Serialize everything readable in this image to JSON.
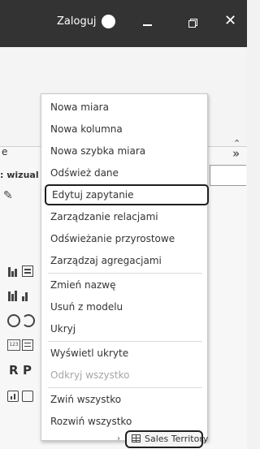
{
  "titlebar": {
    "login_label": "Zaloguj",
    "close_glyph": "✕"
  },
  "ribbon": {
    "caret": "⌃"
  },
  "pane": {
    "partial_header": "e",
    "visualizations_label": ": wizual",
    "expand_glyph": "»",
    "visual_letters": {
      "r": "R",
      "p": "P"
    }
  },
  "context_menu": {
    "items": [
      {
        "label": "Nowa miara",
        "enabled": true
      },
      {
        "label": "Nowa kolumna",
        "enabled": true
      },
      {
        "label": "Nowa szybka miara",
        "enabled": true
      },
      {
        "label": "Odśwież dane",
        "enabled": true
      },
      {
        "label": "Edytuj zapytanie",
        "enabled": true,
        "highlighted": true
      },
      {
        "label": "Zarządzanie relacjami",
        "enabled": true
      },
      {
        "label": "Odświeżanie przyrostowe",
        "enabled": true
      },
      {
        "label": "Zarządzaj agregacjami",
        "enabled": true
      },
      {
        "label": "Zmień nazwę",
        "enabled": true
      },
      {
        "label": "Usuń z modelu",
        "enabled": true
      },
      {
        "label": "Ukryj",
        "enabled": true
      },
      {
        "label": "Wyświetl ukryte",
        "enabled": true
      },
      {
        "label": "Odkryj wszystko",
        "enabled": false
      },
      {
        "label": "Zwiń wszystko",
        "enabled": true
      },
      {
        "label": "Rozwiń wszystko",
        "enabled": true
      }
    ]
  },
  "fields": {
    "table_name": "Sales Territory"
  },
  "icons": [
    "user-avatar-icon",
    "minimize-icon",
    "restore-icon",
    "close-icon",
    "brush-icon",
    "table-icon",
    "chevron-right-icon"
  ]
}
